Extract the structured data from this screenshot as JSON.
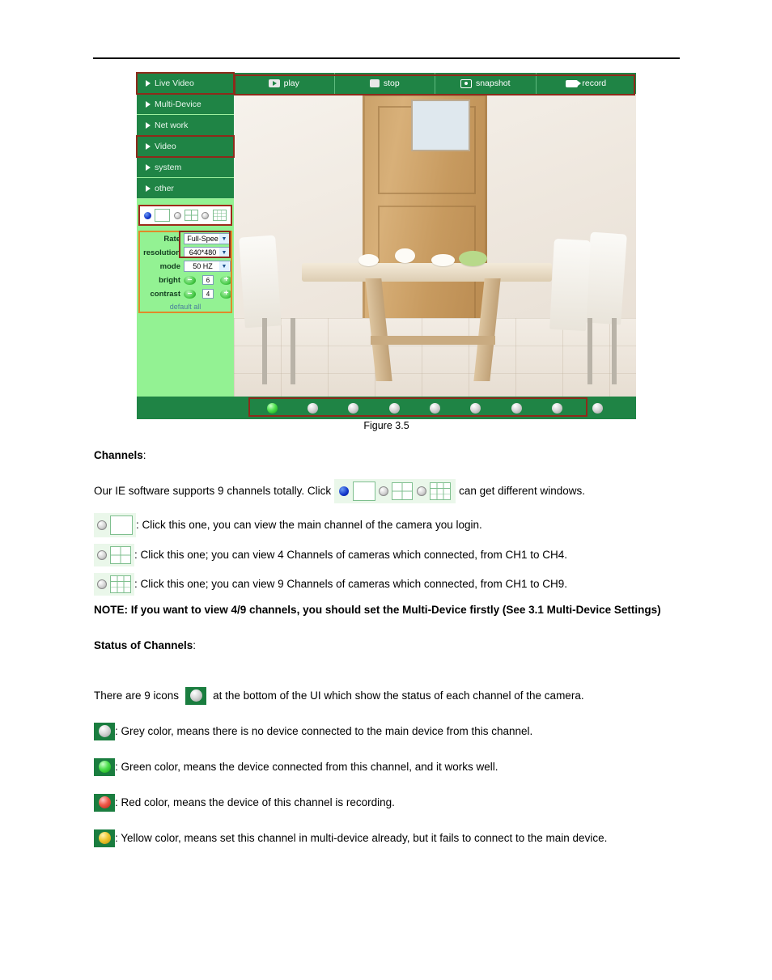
{
  "figure": {
    "caption": "Figure 3.5",
    "sidebar": {
      "items": [
        {
          "label": "Live Video",
          "highlighted": true
        },
        {
          "label": "Multi-Device",
          "highlighted": false
        },
        {
          "label": "Net work",
          "highlighted": false
        },
        {
          "label": "Video",
          "highlighted": true
        },
        {
          "label": "system",
          "highlighted": false
        },
        {
          "label": "other",
          "highlighted": false
        }
      ]
    },
    "toolbar": {
      "buttons": [
        {
          "label": "play",
          "icon": "play-icon"
        },
        {
          "label": "stop",
          "icon": "stop-icon"
        },
        {
          "label": "snapshot",
          "icon": "camera-icon"
        },
        {
          "label": "record",
          "icon": "video-camera-icon"
        }
      ]
    },
    "view_selector": {
      "options": [
        {
          "panes": 1,
          "selected": true
        },
        {
          "panes": 4,
          "selected": false
        },
        {
          "panes": 9,
          "selected": false
        }
      ]
    },
    "settings": {
      "rows": [
        {
          "label": "Rate",
          "value": "Full-Spee",
          "type": "select"
        },
        {
          "label": "resolution",
          "value": "640*480",
          "type": "select"
        },
        {
          "label": "mode",
          "value": "50 HZ",
          "type": "select"
        },
        {
          "label": "bright",
          "value": "6",
          "type": "stepper"
        },
        {
          "label": "contrast",
          "value": "4",
          "type": "stepper"
        }
      ],
      "default_link": "default all",
      "minus_label": "–",
      "plus_label": "+"
    },
    "status_bar": {
      "channels": [
        {
          "state": "green"
        },
        {
          "state": "grey"
        },
        {
          "state": "grey"
        },
        {
          "state": "grey"
        },
        {
          "state": "grey"
        },
        {
          "state": "grey"
        },
        {
          "state": "grey"
        },
        {
          "state": "grey"
        },
        {
          "state": "grey"
        }
      ]
    },
    "colors": {
      "panel_green": "#1f8445",
      "sidebar_light_green": "#93f293",
      "highlight_red": "#8d2b1b",
      "highlight_orange": "#e08a2a",
      "radio_blue": "#1033c8"
    }
  },
  "content": {
    "heading_channels": "Channels",
    "heading_channels_colon": ":",
    "intro_before": "Our IE software supports 9 channels totally. Click",
    "intro_after": "can get different windows.",
    "bullets": [
      {
        "panes": 1,
        "text": ": Click this one, you can view the main channel of the camera you login."
      },
      {
        "panes": 4,
        "text": ": Click this one; you can view 4 Channels of cameras which connected, from CH1 to CH4."
      },
      {
        "panes": 9,
        "text": ": Click this one; you can view 9 Channels of cameras which connected, from CH1 to CH9."
      }
    ],
    "note_label": "NOTE",
    "note_text": ": If you want to view 4/9 channels, you should set the Multi-Device firstly (See 3.1 Multi-Device Settings)",
    "heading_status": "Status of Channels",
    "heading_status_colon": ":",
    "status_intro_before": "There are 9 icons",
    "status_intro_after": "at the bottom of the UI which show the status of each channel of the camera.",
    "status_legend": [
      {
        "state": "grey",
        "text": ": Grey color, means there is no device connected to the main device from this channel."
      },
      {
        "state": "green",
        "text": ": Green color, means the device connected from this channel, and it works well."
      },
      {
        "state": "red",
        "text": ": Red color, means the device of this channel is recording."
      },
      {
        "state": "yellow",
        "text": ": Yellow color, means set this channel in multi-device already, but it fails to connect to the main device."
      }
    ]
  }
}
